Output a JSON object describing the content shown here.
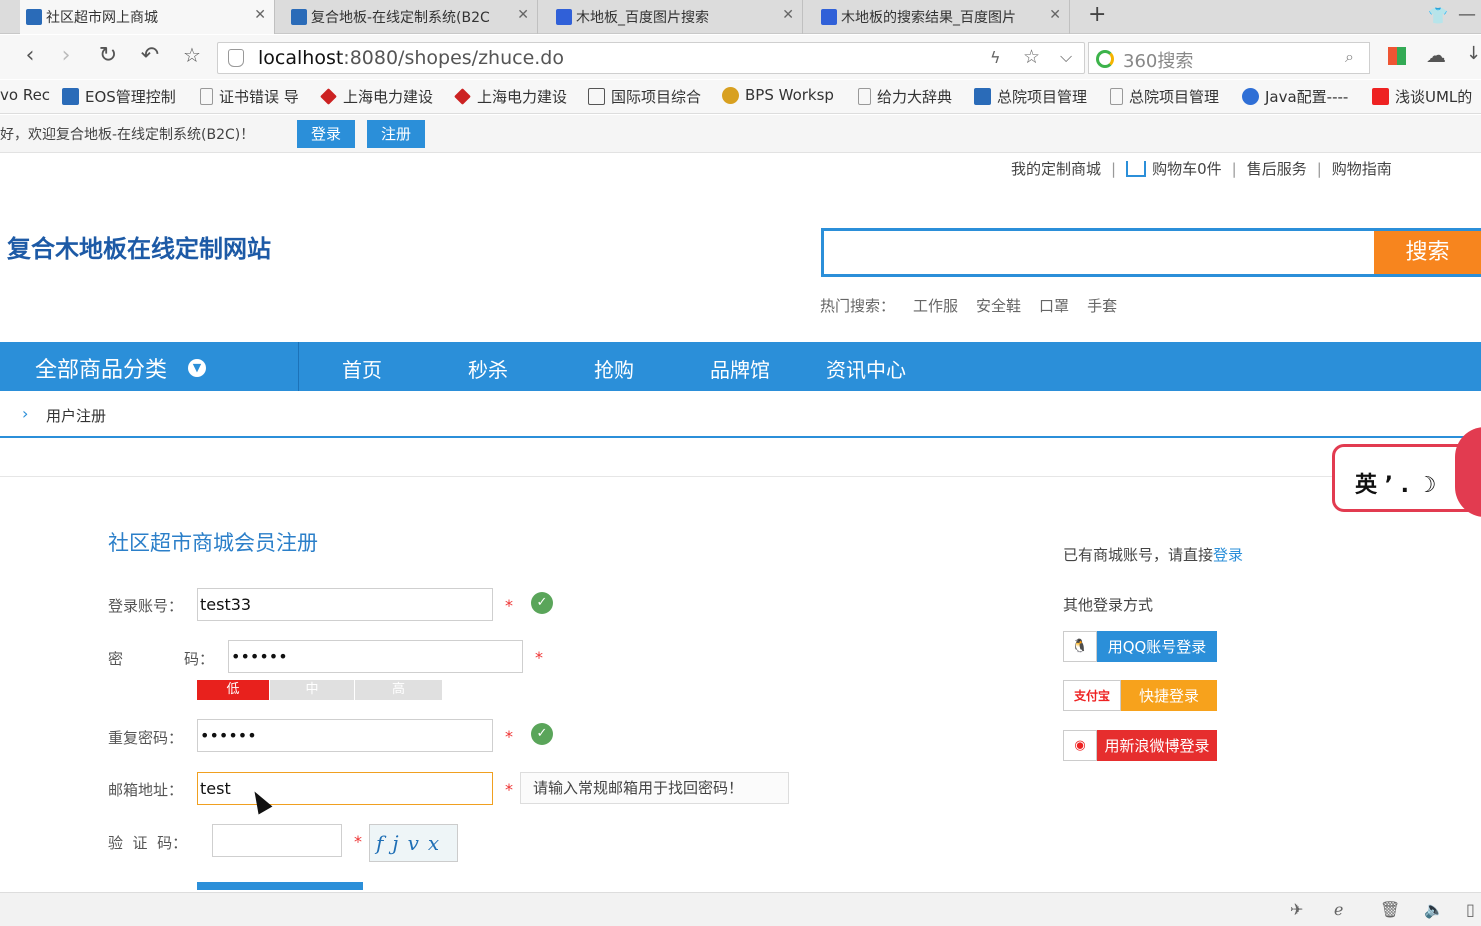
{
  "browser": {
    "tabs": [
      {
        "label": "社区超市网上商城",
        "active": true
      },
      {
        "label": "复合地板-在线定制系统(B2C",
        "active": false
      },
      {
        "label": "木地板_百度图片搜索",
        "active": false
      },
      {
        "label": "木地板的搜索结果_百度图片",
        "active": false
      }
    ],
    "new_tab": "+",
    "address_host": "localhost",
    "address_rest": ":8080/shopes/zhuce.do",
    "search_placeholder": "360搜索",
    "bookmarks": [
      "vo Rec",
      "EOS管理控制",
      "证书错误 导",
      "上海电力建设",
      "上海电力建设",
      "国际项目综合",
      "BPS Worksp",
      "给力大辞典",
      "总院项目管理",
      "总院项目管理",
      "Java配置----",
      "浅谈UML的"
    ]
  },
  "welcome": {
    "text": "好，欢迎复合地板-在线定制系统(B2C)！",
    "login": "登录",
    "register": "注册"
  },
  "toplinks": {
    "my_shop": "我的定制商城",
    "cart": "购物车0件",
    "service": "售后服务",
    "guide": "购物指南"
  },
  "site": {
    "title": "复合木地板在线定制网站",
    "search_button": "搜索",
    "hot_label": "热门搜索：",
    "hot": [
      "工作服",
      "安全鞋",
      "口罩",
      "手套"
    ]
  },
  "nav": {
    "all_categories": "全部商品分类",
    "items": [
      "首页",
      "秒杀",
      "抢购",
      "品牌馆",
      "资讯中心"
    ]
  },
  "breadcrumb": "用户注册",
  "ime": {
    "text": "英 ’ .  ☽"
  },
  "form": {
    "title": "社区超市商城会员注册",
    "account_label": "登录账号：",
    "account_value": "test33",
    "password_label_1": "密",
    "password_label_2": "码：",
    "password_value": "••••••",
    "strength": [
      "低",
      "中",
      "高"
    ],
    "repeat_label": "重复密码：",
    "repeat_value": "••••••",
    "email_label": "邮箱地址：",
    "email_value": "test",
    "email_hint": "请输入常规邮箱用于找回密码！",
    "captcha_label": "验  证  码：",
    "captcha_text": "fjvx",
    "required_mark": "*"
  },
  "sidebar": {
    "has_account": "已有商城账号，请直接",
    "login_link": "登录",
    "other_login": "其他登录方式",
    "qq": "用QQ账号登录",
    "alipay_icon": "支付宝",
    "alipay": "快捷登录",
    "weibo": "用新浪微博登录"
  },
  "colors": {
    "primary": "#2b8fd9",
    "search_button": "#f7851e",
    "weak": "#e8211d",
    "alipay": "#f7a21c",
    "weibo": "#e62e2e"
  }
}
